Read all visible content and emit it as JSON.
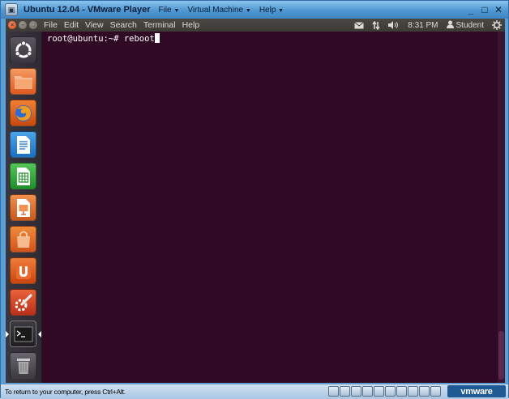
{
  "vm": {
    "title": "Ubuntu 12.04 - VMware Player",
    "menu": [
      {
        "label": "File"
      },
      {
        "label": "Virtual Machine"
      },
      {
        "label": "Help"
      }
    ],
    "window_controls": {
      "minimize": "_",
      "maximize": "□",
      "close": "✕"
    },
    "status_text": "To return to your computer, press Ctrl+Alt.",
    "brand": "vmware"
  },
  "guest": {
    "app_menu": [
      "File",
      "Edit",
      "View",
      "Search",
      "Terminal",
      "Help"
    ],
    "indicators": {
      "mail_icon": "envelope-icon",
      "network_icon": "network-arrows-icon",
      "sound_icon": "speaker-icon",
      "clock": "8:31 PM",
      "user": "Student",
      "session_icon": "power-gear-icon"
    },
    "launcher": [
      {
        "name": "dash-home",
        "icon": "ubuntu-logo-icon"
      },
      {
        "name": "home-folder",
        "icon": "folder-icon"
      },
      {
        "name": "firefox",
        "icon": "firefox-icon"
      },
      {
        "name": "libreoffice-writer",
        "icon": "writer-icon"
      },
      {
        "name": "libreoffice-calc",
        "icon": "calc-icon"
      },
      {
        "name": "libreoffice-impress",
        "icon": "impress-icon"
      },
      {
        "name": "software-center",
        "icon": "shopping-bag-icon"
      },
      {
        "name": "ubuntu-one",
        "icon": "ubuntu-one-icon"
      },
      {
        "name": "system-settings",
        "icon": "settings-wrench-icon"
      },
      {
        "name": "terminal",
        "icon": "terminal-icon"
      },
      {
        "name": "trash",
        "icon": "trash-icon"
      }
    ],
    "terminal": {
      "prompt": "root@ubuntu:~# ",
      "command": "reboot"
    }
  },
  "colors": {
    "terminal_bg": "#300a24",
    "ubuntu_orange": "#dd4814",
    "vm_chrome": "#5aa0d6"
  }
}
